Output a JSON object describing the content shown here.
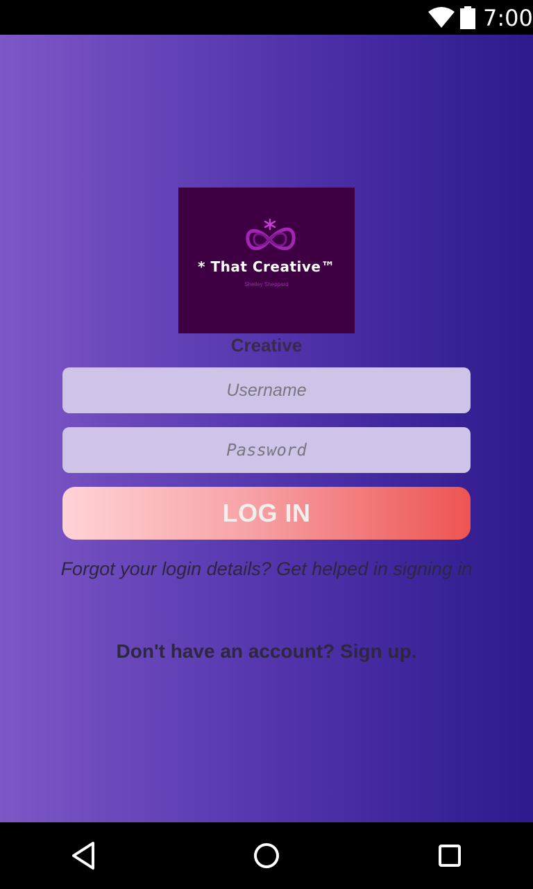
{
  "status_bar": {
    "time": "7:00",
    "wifi_icon": "wifi-icon",
    "battery_icon": "battery-icon"
  },
  "logo": {
    "icon": "infinity-icon",
    "brand_text": "* That Creative™",
    "sub_text": "Shelley Sheppard"
  },
  "app_name": "Creative",
  "form": {
    "username_placeholder": "Username",
    "username_value": "",
    "password_placeholder": "Password",
    "password_value": "",
    "login_label": "LOG IN"
  },
  "links": {
    "forgot": "Forgot your login details? Get helped in signing in",
    "signup": "Don't have an account? Sign up."
  },
  "nav_bar": {
    "back_icon": "back-triangle-icon",
    "home_icon": "home-circle-icon",
    "recent_icon": "recent-apps-square-icon"
  },
  "colors": {
    "gradient_start": "#7e57c6",
    "gradient_end": "#2e1a8c",
    "logo_bg": "#3e0042",
    "input_bg": "#cfc4e8",
    "button_start": "#ffd3d6",
    "button_end": "#ed5452"
  }
}
